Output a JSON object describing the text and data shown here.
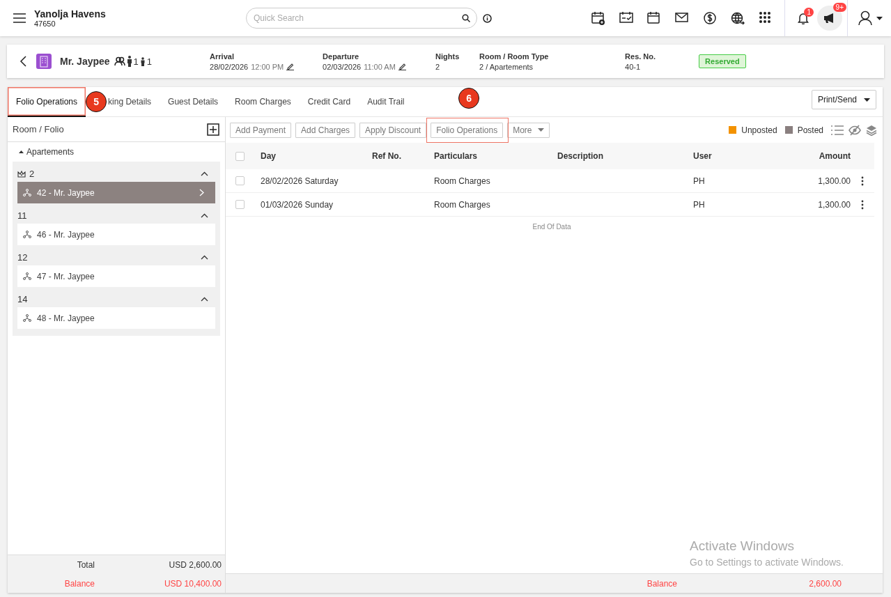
{
  "header": {
    "hotel_name": "Yanolja Havens",
    "hotel_code": "47650",
    "search": {
      "placeholder": "Quick Search"
    },
    "notification_count": "1",
    "announcement_count": "9+"
  },
  "reservation": {
    "guest_name": "Mr. Jaypee",
    "adults": "1",
    "children": "1",
    "fields": [
      {
        "kind": "datetime",
        "label": "Arrival",
        "date": "28/02/2026",
        "time": "12:00 PM"
      },
      {
        "kind": "datetime",
        "label": "Departure",
        "date": "02/03/2026",
        "time": "11:00 AM"
      },
      {
        "kind": "text",
        "label": "Nights",
        "value": "2"
      },
      {
        "kind": "text",
        "label": "Room / Room Type",
        "value": "2 / Apartements"
      },
      {
        "kind": "text",
        "label": "Res. No.",
        "value": "40-1"
      }
    ],
    "status": "Reserved"
  },
  "tabs": [
    {
      "label": "Folio Operations",
      "selected": true,
      "callout": "5"
    },
    {
      "label": "king Details",
      "selected": false
    },
    {
      "label": "Guest Details",
      "selected": false
    },
    {
      "label": "Room Charges",
      "selected": false
    },
    {
      "label": "Credit Card",
      "selected": false
    },
    {
      "label": "Audit Trail",
      "selected": false
    }
  ],
  "print_button": "Print/Send",
  "folio_panel": {
    "title": "Room / Folio",
    "room_type": "Apartements",
    "groups": [
      {
        "room": "2",
        "master": true,
        "expanded": true,
        "folios": [
          {
            "label": "42 - Mr. Jaypee",
            "selected": true
          }
        ]
      },
      {
        "room": "11",
        "master": false,
        "expanded": true,
        "folios": [
          {
            "label": "46 - Mr. Jaypee",
            "selected": false
          }
        ]
      },
      {
        "room": "12",
        "master": false,
        "expanded": true,
        "folios": [
          {
            "label": "47 - Mr. Jaypee",
            "selected": false
          }
        ]
      },
      {
        "room": "14",
        "master": false,
        "expanded": true,
        "folios": [
          {
            "label": "48 - Mr. Jaypee",
            "selected": false
          }
        ]
      }
    ],
    "total_label": "Total",
    "total": "USD 2,600.00",
    "balance_label": "Balance",
    "balance": "USD 10,400.00"
  },
  "toolbar": {
    "buttons": [
      {
        "label": "Add Payment"
      },
      {
        "label": "Add Charges"
      },
      {
        "label": "Apply Discount"
      },
      {
        "label": "Folio Operations",
        "callout": "6"
      }
    ],
    "more": "More",
    "legend": [
      {
        "label": "Unposted",
        "color": "#f39200"
      },
      {
        "label": "Posted",
        "color": "#8a7f7f"
      }
    ]
  },
  "table": {
    "all_selected": false,
    "columns": [
      "Day",
      "Ref No.",
      "Particulars",
      "Description",
      "User",
      "Amount"
    ],
    "rows": [
      {
        "checked": false,
        "day": "28/02/2026 Saturday",
        "particulars": "Room Charges",
        "user": "PH",
        "amount": "1,300.00"
      },
      {
        "checked": false,
        "day": "01/03/2026 Sunday",
        "particulars": "Room Charges",
        "user": "PH",
        "amount": "1,300.00"
      }
    ],
    "end_text": "End Of Data",
    "balance_label": "Balance",
    "balance": "2,600.00"
  },
  "os_notice": {
    "title": "Activate Windows",
    "text": "Go to Settings to activate Windows."
  }
}
